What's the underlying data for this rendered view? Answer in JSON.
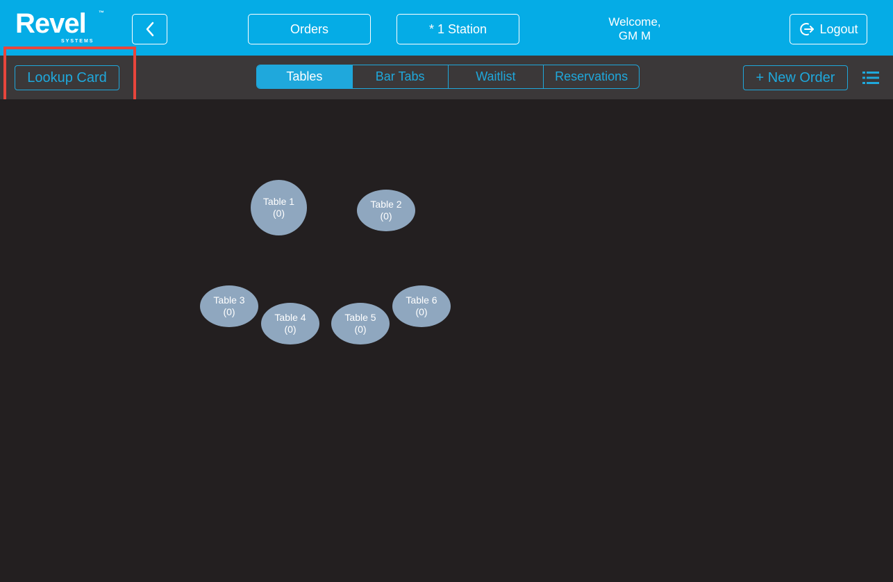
{
  "header": {
    "logo_text": "Revel",
    "logo_tm": "™",
    "logo_sub": "SYSTEMS",
    "back_icon": "chevron-left-icon",
    "orders_label": "Orders",
    "station_label": "* 1 Station",
    "welcome_line1": "Welcome,",
    "welcome_line2": "GM M",
    "logout_label": "Logout",
    "logout_icon": "logout-icon"
  },
  "subbar": {
    "lookup_label": "Lookup Card",
    "tabs": [
      {
        "label": "Tables",
        "active": true
      },
      {
        "label": "Bar Tabs",
        "active": false
      },
      {
        "label": "Waitlist",
        "active": false
      },
      {
        "label": "Reservations",
        "active": false
      }
    ],
    "new_order_label": "+ New Order",
    "menu_icon": "list-icon"
  },
  "floor": {
    "tables": [
      {
        "name": "Table 1",
        "count": "(0)"
      },
      {
        "name": "Table 2",
        "count": "(0)"
      },
      {
        "name": "Table 3",
        "count": "(0)"
      },
      {
        "name": "Table 4",
        "count": "(0)"
      },
      {
        "name": "Table 5",
        "count": "(0)"
      },
      {
        "name": "Table 6",
        "count": "(0)"
      }
    ]
  },
  "colors": {
    "header_bg": "#05ace6",
    "subbar_bg": "#3b3839",
    "floor_bg": "#231f20",
    "accent": "#1fa8dc",
    "table_fill": "#8fa7bf",
    "highlight": "#e8453c"
  }
}
